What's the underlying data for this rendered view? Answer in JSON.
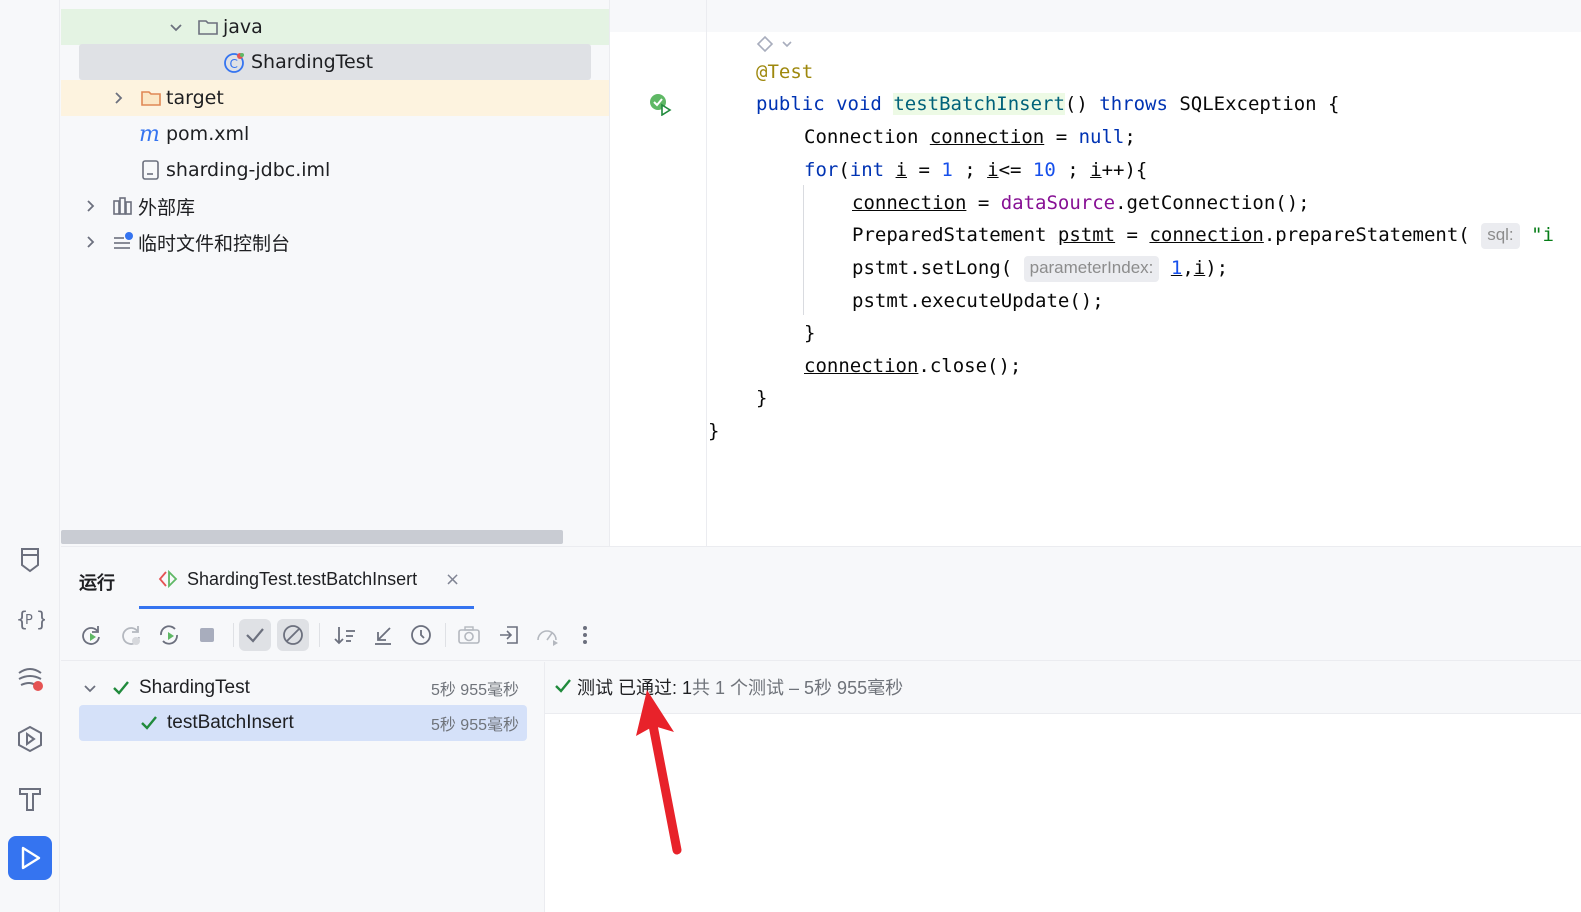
{
  "project_tree": {
    "items": [
      {
        "label": "java",
        "type": "folder",
        "expanded": true
      },
      {
        "label": "ShardingTest",
        "type": "test-class",
        "selected": true
      },
      {
        "label": "target",
        "type": "folder",
        "expanded": false
      },
      {
        "label": "pom.xml",
        "type": "maven-file"
      },
      {
        "label": "sharding-jdbc.iml",
        "type": "iml-file"
      },
      {
        "label": "外部库",
        "type": "library",
        "expanded": false
      },
      {
        "label": "临时文件和控制台",
        "type": "scratches",
        "expanded": false
      }
    ]
  },
  "editor": {
    "annotation": "@Test",
    "signature": {
      "kw1": "public",
      "kw2": "void",
      "method": "testBatchInsert",
      "paren": "()",
      "throws": "throws",
      "exception": "SQLException {"
    },
    "line1": {
      "type": "Connection",
      "var": "connection",
      "eq": "=",
      "val": "null",
      "end": ";"
    },
    "line2": {
      "kw": "for",
      "p1": "(",
      "int": "int",
      "i": "i",
      "eq": " = ",
      "one": "1",
      "mid": " ; ",
      "i2": "i",
      "le": "<= ",
      "ten": "10",
      "mid2": " ; ",
      "i3": "i",
      "end": "++){"
    },
    "line3": {
      "var": "connection",
      "eq": " = ",
      "field": "dataSource",
      "call": ".getConnection();"
    },
    "line4": {
      "type": "PreparedStatement ",
      "var": "pstmt",
      "eq": " = ",
      "conn": "connection",
      "call": ".prepareStatement(",
      "hint": "sql:",
      "str": "\"i"
    },
    "line5": {
      "prefix": "pstmt.setLong(",
      "hint": "parameterIndex:",
      "one": "1",
      "comma": ",",
      "i": "i",
      "end": ");"
    },
    "line6": {
      "text": "pstmt.executeUpdate();"
    },
    "line7": {
      "text": "}"
    },
    "line8": {
      "var": "connection",
      "call": ".close();"
    },
    "line9": {
      "text": "}"
    },
    "line10": {
      "text": "}"
    }
  },
  "run_panel": {
    "title": "运行",
    "tab_label": "ShardingTest.testBatchInsert",
    "tab_close": "×",
    "tests": [
      {
        "label": "ShardingTest",
        "time": "5秒 955毫秒",
        "status": "passed"
      },
      {
        "label": "testBatchInsert",
        "time": "5秒 955毫秒",
        "status": "passed"
      }
    ],
    "status_main": "测试 已通过: 1",
    "status_sub": "共 1 个测试 – 5秒 955毫秒"
  },
  "colors": {
    "accent": "#3574f0",
    "pass": "#208a3c",
    "arrow": "#e8222a"
  }
}
